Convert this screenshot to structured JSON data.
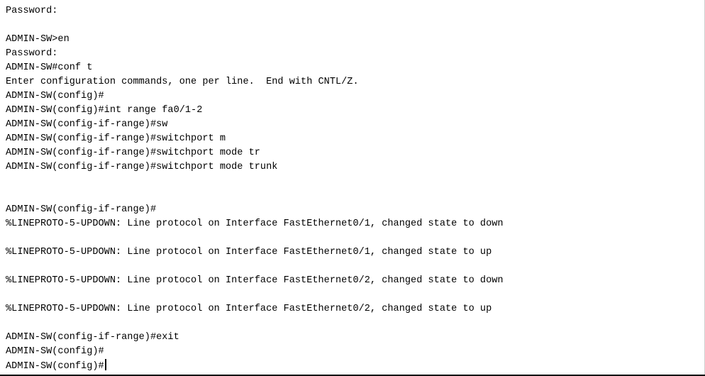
{
  "terminal": {
    "lines": [
      "Password:",
      "",
      "ADMIN-SW>en",
      "Password:",
      "ADMIN-SW#conf t",
      "Enter configuration commands, one per line.  End with CNTL/Z.",
      "ADMIN-SW(config)#",
      "ADMIN-SW(config)#int range fa0/1-2",
      "ADMIN-SW(config-if-range)#sw",
      "ADMIN-SW(config-if-range)#switchport m",
      "ADMIN-SW(config-if-range)#switchport mode tr",
      "ADMIN-SW(config-if-range)#switchport mode trunk",
      "",
      "",
      "ADMIN-SW(config-if-range)#",
      "%LINEPROTO-5-UPDOWN: Line protocol on Interface FastEthernet0/1, changed state to down",
      "",
      "%LINEPROTO-5-UPDOWN: Line protocol on Interface FastEthernet0/1, changed state to up",
      "",
      "%LINEPROTO-5-UPDOWN: Line protocol on Interface FastEthernet0/2, changed state to down",
      "",
      "%LINEPROTO-5-UPDOWN: Line protocol on Interface FastEthernet0/2, changed state to up",
      "",
      "ADMIN-SW(config-if-range)#exit",
      "ADMIN-SW(config)#"
    ],
    "prompt": "ADMIN-SW(config)#",
    "input_value": ""
  }
}
